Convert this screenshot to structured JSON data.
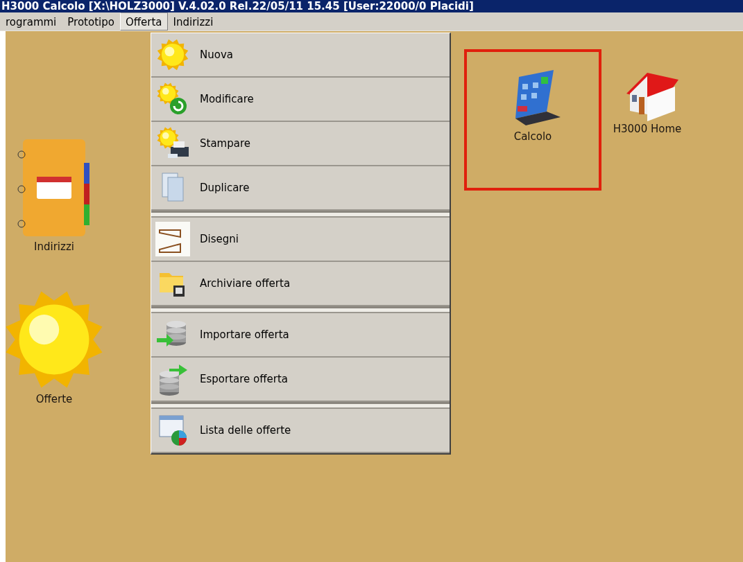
{
  "window": {
    "title": "H3000 Calcolo      [X:\\HOLZ3000] V.4.02.0 Rel.22/05/11 15.45 [User:22000/0 Placidi]"
  },
  "menubar": [
    {
      "label": "rogrammi",
      "selected": false
    },
    {
      "label": "Prototipo",
      "selected": false
    },
    {
      "label": "Offerta",
      "selected": true
    },
    {
      "label": "Indirizzi",
      "selected": false
    }
  ],
  "dropdown": {
    "groups": [
      {
        "items": [
          {
            "label": "Nuova"
          },
          {
            "label": "Modificare"
          },
          {
            "label": "Stampare"
          },
          {
            "label": "Duplicare"
          }
        ]
      },
      {
        "items": [
          {
            "label": "Disegni"
          },
          {
            "label": "Archiviare offerta"
          }
        ]
      },
      {
        "items": [
          {
            "label": "Importare offerta"
          },
          {
            "label": "Esportare offerta"
          }
        ]
      },
      {
        "items": [
          {
            "label": "Lista delle offerte"
          }
        ]
      }
    ]
  },
  "desktop_icons": [
    {
      "label": "Indirizzi",
      "highlighted": false
    },
    {
      "label": "Offerte",
      "highlighted": false
    },
    {
      "label": "Calcolo",
      "highlighted": true
    },
    {
      "label": "H3000 Home",
      "highlighted": false
    }
  ]
}
